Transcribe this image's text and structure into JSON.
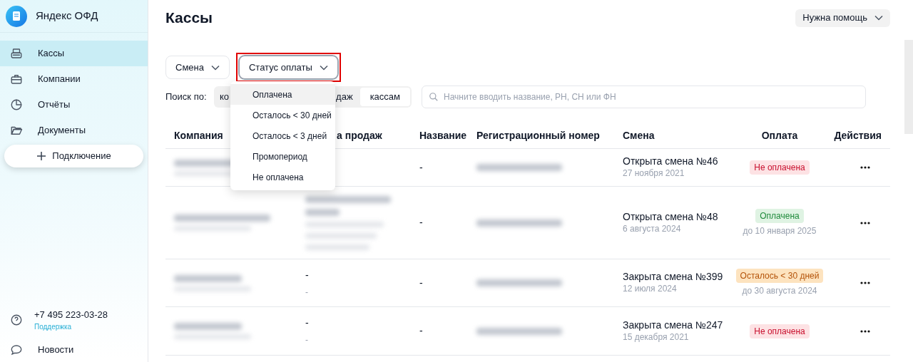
{
  "sidebar": {
    "brand": "Яндекс ОФД",
    "items": [
      {
        "label": "Кассы",
        "selected": true
      },
      {
        "label": "Компании",
        "selected": false
      },
      {
        "label": "Отчёты",
        "selected": false
      },
      {
        "label": "Документы",
        "selected": false
      }
    ],
    "connect_button": "Подключение",
    "support": {
      "phone": "+7 495 223-03-28",
      "link": "Поддержка"
    },
    "news": "Новости"
  },
  "header": {
    "title": "Кассы",
    "help_button": "Нужна помощь"
  },
  "filters": [
    {
      "label": "Смена",
      "highlighted": false
    },
    {
      "label": "Статус оплаты",
      "highlighted": true
    }
  ],
  "search": {
    "label": "Поиск по:",
    "segments": [
      {
        "label": "ко",
        "selected": false
      },
      {
        "label": "даж",
        "selected": false
      },
      {
        "label": "кассам",
        "selected": true
      }
    ],
    "placeholder": "Начните вводить название, РН, СН или ФН"
  },
  "dropdown": {
    "items": [
      {
        "label": "Оплачена",
        "highlighted": true
      },
      {
        "label": "Осталось < 30 дней",
        "highlighted": false
      },
      {
        "label": "Осталось < 3 дней",
        "highlighted": false
      },
      {
        "label": "Промопериод",
        "highlighted": false
      },
      {
        "label": "Не оплачена",
        "highlighted": false
      }
    ]
  },
  "table": {
    "columns": [
      "Компания",
      "а продаж",
      "Название",
      "Регистрационный номер",
      "Смена",
      "Оплата",
      "Действия"
    ],
    "rows": [
      {
        "sale_point": {
          "kind": "hidden"
        },
        "name": "-",
        "shift": "Открыта смена №46",
        "shift_date": "27 ноября 2021",
        "payment": {
          "kind": "unpaid",
          "label": "Не оплачена"
        }
      },
      {
        "sale_point": {
          "kind": "blurred"
        },
        "name": "-",
        "shift": "Открыта смена №48",
        "shift_date": "6 августа 2024",
        "payment": {
          "kind": "paid",
          "label": "Оплачена",
          "until": "до 10 января 2025"
        }
      },
      {
        "sale_point": {
          "kind": "dash",
          "line1": "-",
          "line2": "-"
        },
        "name": "-",
        "shift": "Закрыта смена №399",
        "shift_date": "12 июля 2024",
        "payment": {
          "kind": "warning",
          "label": "Осталось < 30 дней",
          "until": "до 30 августа 2024"
        }
      },
      {
        "sale_point": {
          "kind": "dash",
          "line1": "-",
          "line2": "-"
        },
        "name": "-",
        "shift": "Закрыта смена №247",
        "shift_date": "15 декабря 2021",
        "payment": {
          "kind": "unpaid",
          "label": "Не оплачена"
        }
      }
    ]
  }
}
